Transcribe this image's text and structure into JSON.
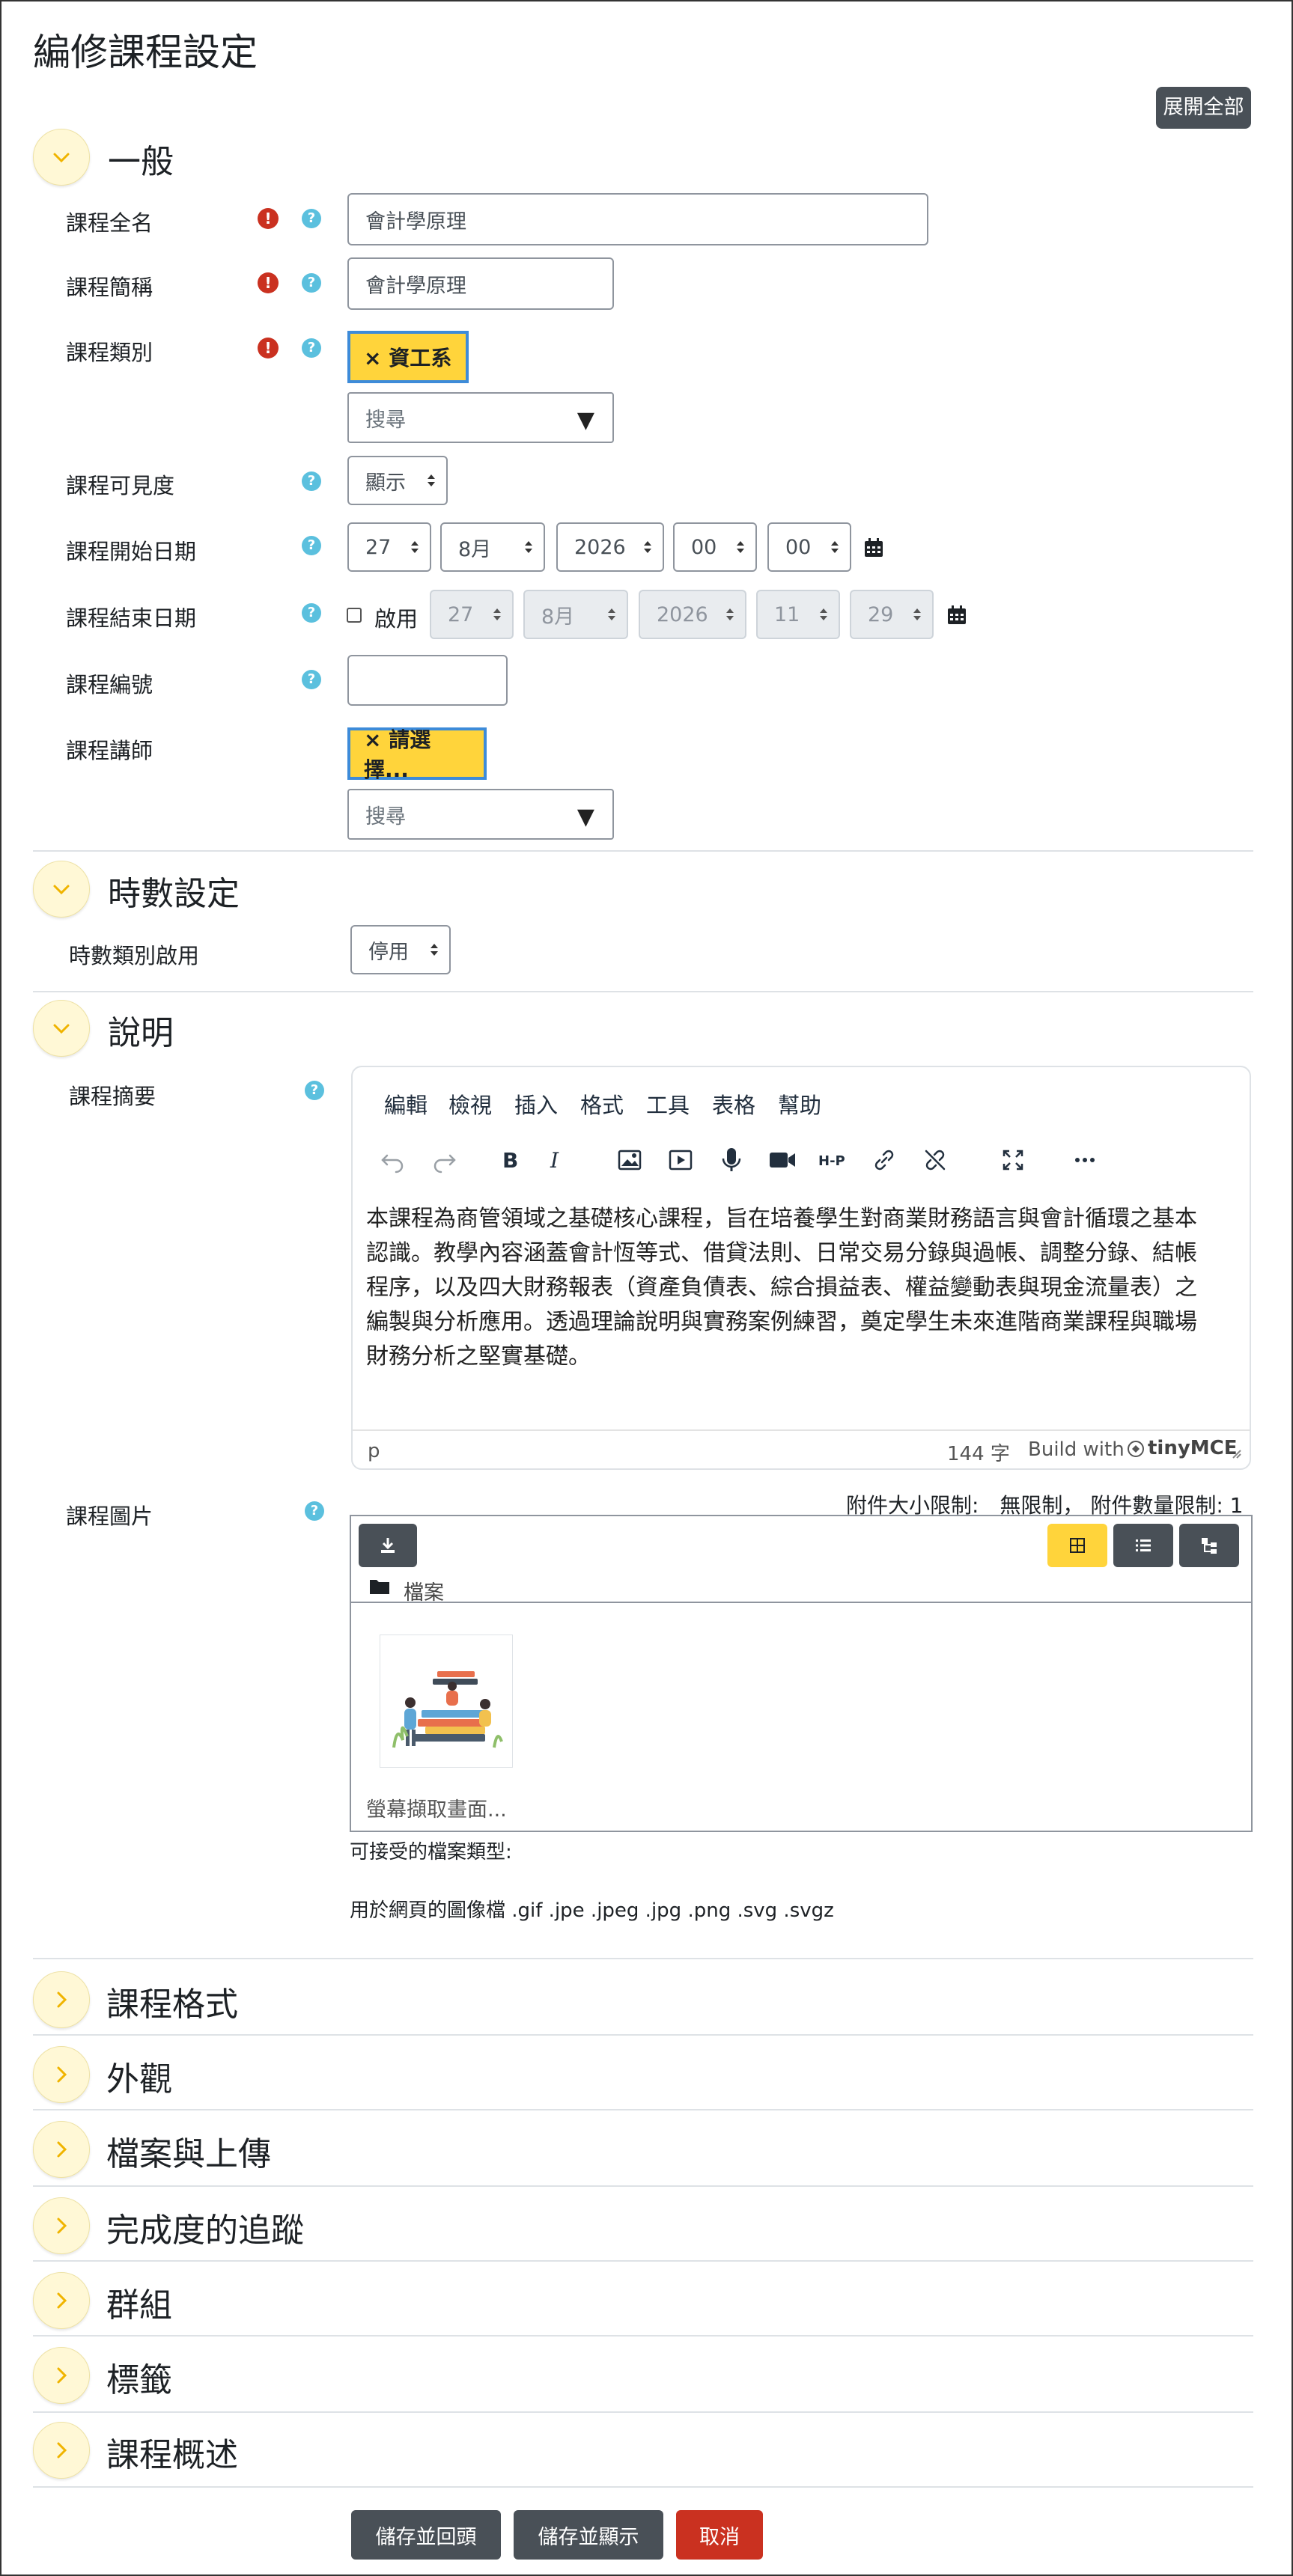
{
  "page": {
    "title": "編修課程設定",
    "expand_all": "展開全部"
  },
  "sections": {
    "general": "一般",
    "hours": "時數設定",
    "description": "說明",
    "collapsed": [
      "課程格式",
      "外觀",
      "檔案與上傳",
      "完成度的追蹤",
      "群組",
      "標籤",
      "課程概述"
    ]
  },
  "general": {
    "fullname": {
      "label": "課程全名",
      "value": "會計學原理"
    },
    "shortname": {
      "label": "課程簡稱",
      "value": "會計學原理"
    },
    "category": {
      "label": "課程類別",
      "tag": "× 資工系",
      "search_placeholder": "搜尋"
    },
    "visibility": {
      "label": "課程可見度",
      "value": "顯示"
    },
    "startdate": {
      "label": "課程開始日期",
      "day": "27",
      "month": "8月",
      "year": "2026",
      "hour": "00",
      "minute": "00"
    },
    "enddate": {
      "label": "課程結束日期",
      "enable_label": "啟用",
      "enabled": false,
      "day": "27",
      "month": "8月",
      "year": "2026",
      "hour": "11",
      "minute": "29"
    },
    "idnumber": {
      "label": "課程編號",
      "value": ""
    },
    "teacher": {
      "label": "課程講師",
      "tag": "× 請選擇...",
      "search_placeholder": "搜尋"
    }
  },
  "hours": {
    "enable": {
      "label": "時數類別啟用",
      "value": "停用"
    }
  },
  "description": {
    "summary_label": "課程摘要",
    "editor_menu": [
      "編輯",
      "檢視",
      "插入",
      "格式",
      "工具",
      "表格",
      "幫助"
    ],
    "editor_lines": [
      "本課程為商管領域之基礎核心課程，旨在培養學生對商業財務語言與會計循環之基本",
      "認識。教學內容涵蓋會計恆等式、借貸法則、日常交易分錄與過帳、調整分錄、結帳",
      "程序，以及四大財務報表（資產負債表、綜合損益表、權益變動表與現金流量表）之",
      "編製與分析應用。透過理論說明與實務案例練習，奠定學生未來進階商業課程與職場",
      "財務分析之堅實基礎。"
    ],
    "status_path": "p",
    "word_count": "144 字",
    "build_with": "Build with",
    "tinymce": "tinyMCE",
    "image_label": "課程圖片",
    "limits": "附件大小限制:　無限制， 附件數量限制: 1",
    "folder_label": "檔案",
    "file_name": "螢幕擷取畫面...",
    "accepted_title": "可接受的檔案類型:",
    "accepted_types": "用於網頁的圖像檔 .gif .jpe .jpeg .jpg .png .svg .svgz"
  },
  "buttons": {
    "save_return": "儲存並回頭",
    "save_display": "儲存並顯示",
    "cancel": "取消"
  },
  "colors": {
    "accent_yellow": "#ffd43b",
    "dark_button": "#495057",
    "cancel_red": "#ca3120",
    "help_blue": "#5bc0de",
    "required_red": "#ca3120"
  }
}
